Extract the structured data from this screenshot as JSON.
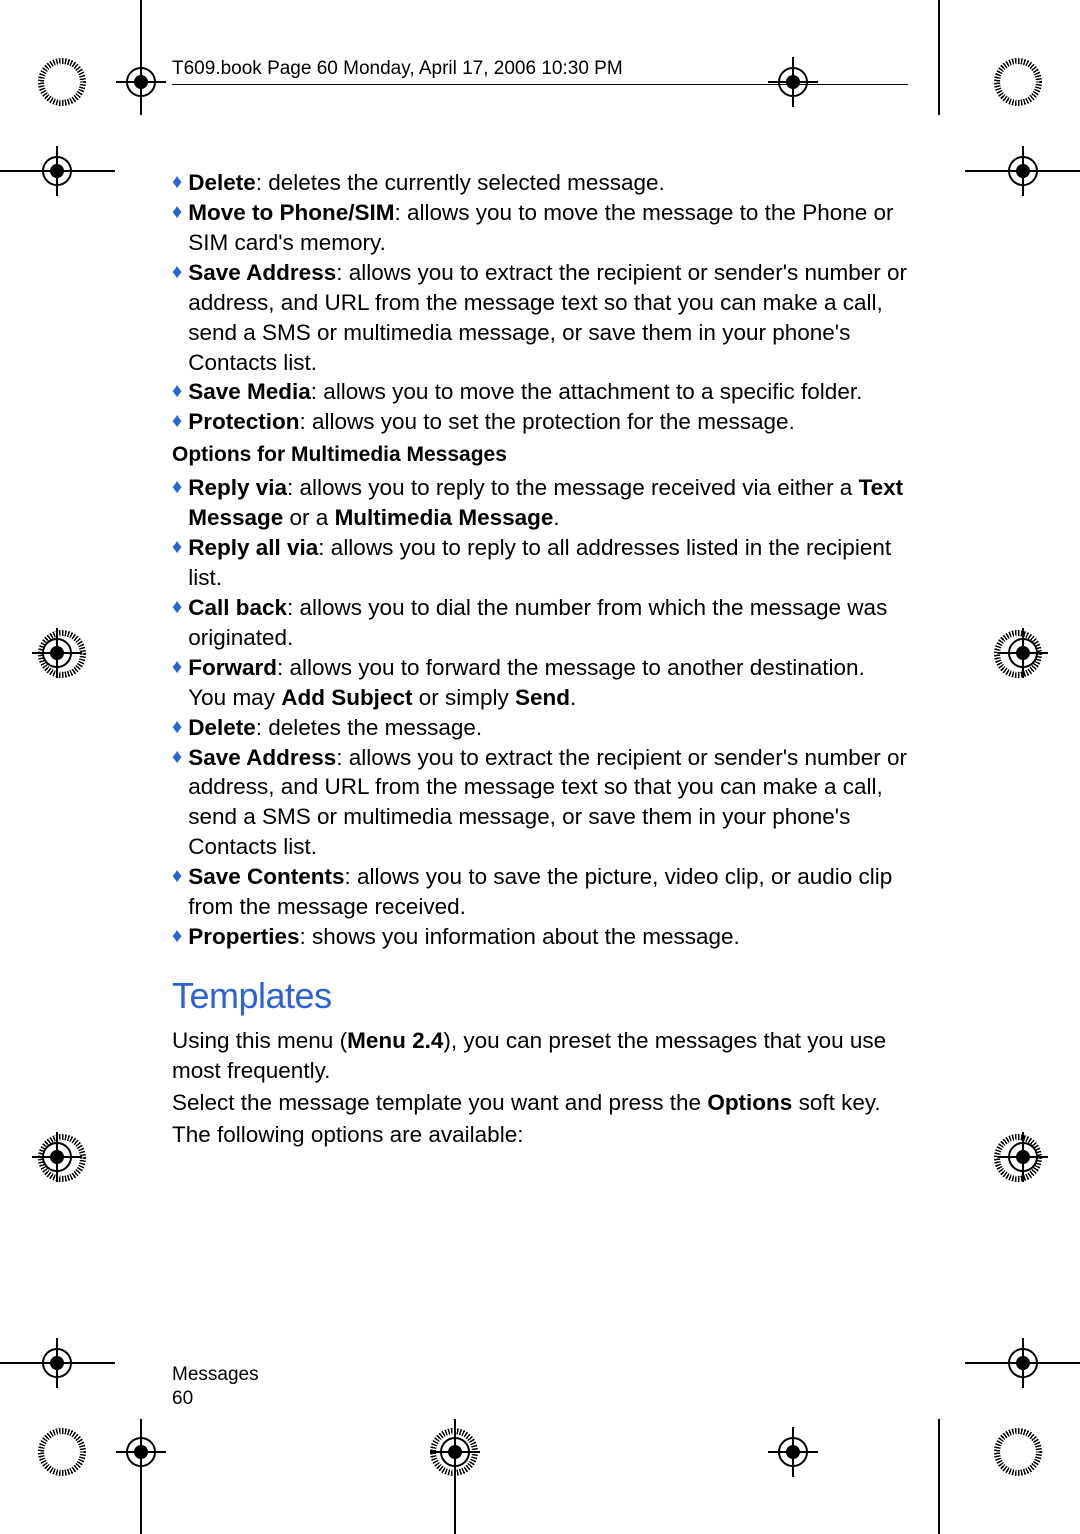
{
  "header": "T609.book  Page 60  Monday, April 17, 2006  10:30 PM",
  "items_a": [
    {
      "term": "Delete",
      "text": ": deletes the currently selected message."
    },
    {
      "term": "Move to Phone/SIM",
      "text": ": allows you to move the message to the Phone or SIM card's memory."
    },
    {
      "term": "Save Address",
      "text": ": allows you to extract the recipient or sender's number or address, and URL from the message text so that you can make a call, send a SMS or multimedia message, or save them in your phone's Contacts list."
    },
    {
      "term": "Save Media",
      "text": ": allows you to move the attachment to a specific folder."
    },
    {
      "term": "Protection",
      "text": ": allows you to set the protection for the message."
    }
  ],
  "subheading_a": "Options for Multimedia Messages",
  "items_b": [
    {
      "term": "Reply via",
      "text_before": ": allows you to reply to the message received via either a ",
      "bold1": "Text Message",
      "mid": " or a ",
      "bold2": "Multimedia Message",
      "after": "."
    },
    {
      "term": "Reply all via",
      "text": ": allows you to reply to all addresses listed in the recipient list."
    },
    {
      "term": "Call back",
      "text": ": allows you to dial the number from which the message was originated."
    },
    {
      "term": "Forward",
      "text_before": ": allows you to forward the message to another destination. You may ",
      "bold1": "Add Subject",
      "mid": " or simply ",
      "bold2": "Send",
      "after": "."
    },
    {
      "term": "Delete",
      "text": ": deletes the message."
    },
    {
      "term": "Save Address",
      "text": ": allows you to extract the recipient or sender's number or address, and URL from the message text so that you can make a call, send a SMS or multimedia message, or save them in your phone's Contacts list."
    },
    {
      "term": "Save Contents",
      "text": ": allows you to save the picture, video clip, or audio clip from the message received."
    },
    {
      "term": "Properties",
      "text": ": shows you information about the message."
    }
  ],
  "section_heading": "Templates",
  "templates_p1_a": "Using this menu (",
  "templates_p1_bold": "Menu 2.4",
  "templates_p1_b": "), you can preset the messages that you use most frequently.",
  "templates_p2_a": "Select the message template you want and press the ",
  "templates_p2_bold": "Options",
  "templates_p2_b": " soft key.",
  "templates_p3": "The following options are available:",
  "footer_section": "Messages",
  "footer_page": "60"
}
